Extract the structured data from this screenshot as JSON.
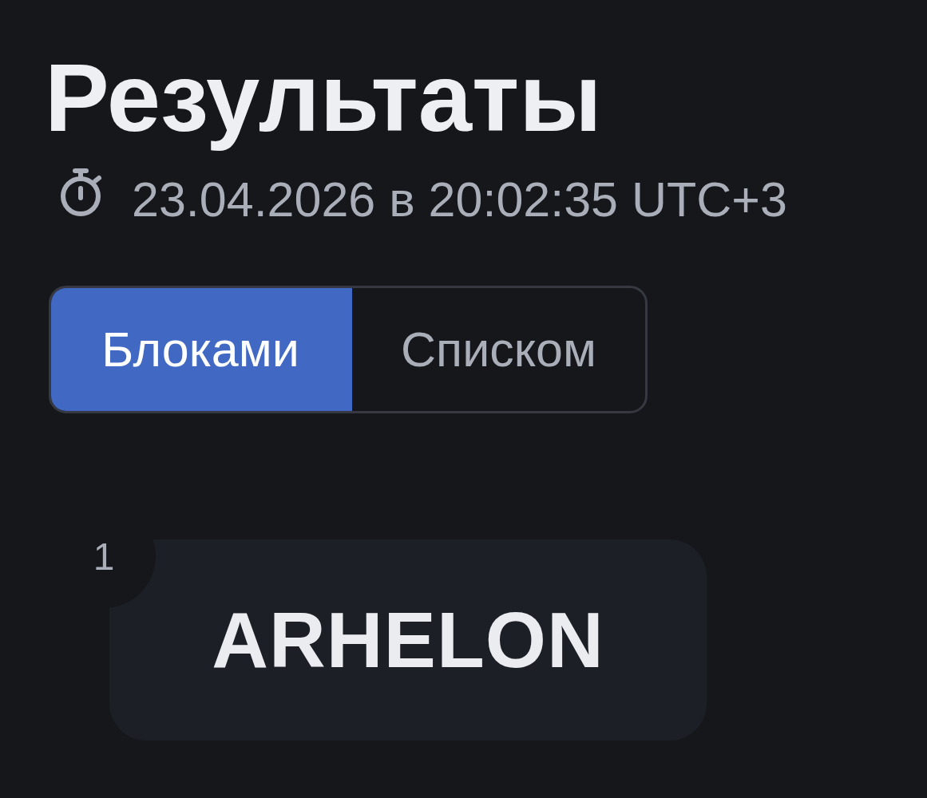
{
  "page": {
    "title": "Результаты",
    "timestamp": "23.04.2026 в 20:02:35 UTC+3"
  },
  "view_toggle": [
    {
      "label": "Блоками",
      "selected": true
    },
    {
      "label": "Списком",
      "selected": false
    }
  ],
  "results": [
    {
      "rank": "1",
      "name": "ARHELON"
    }
  ]
}
